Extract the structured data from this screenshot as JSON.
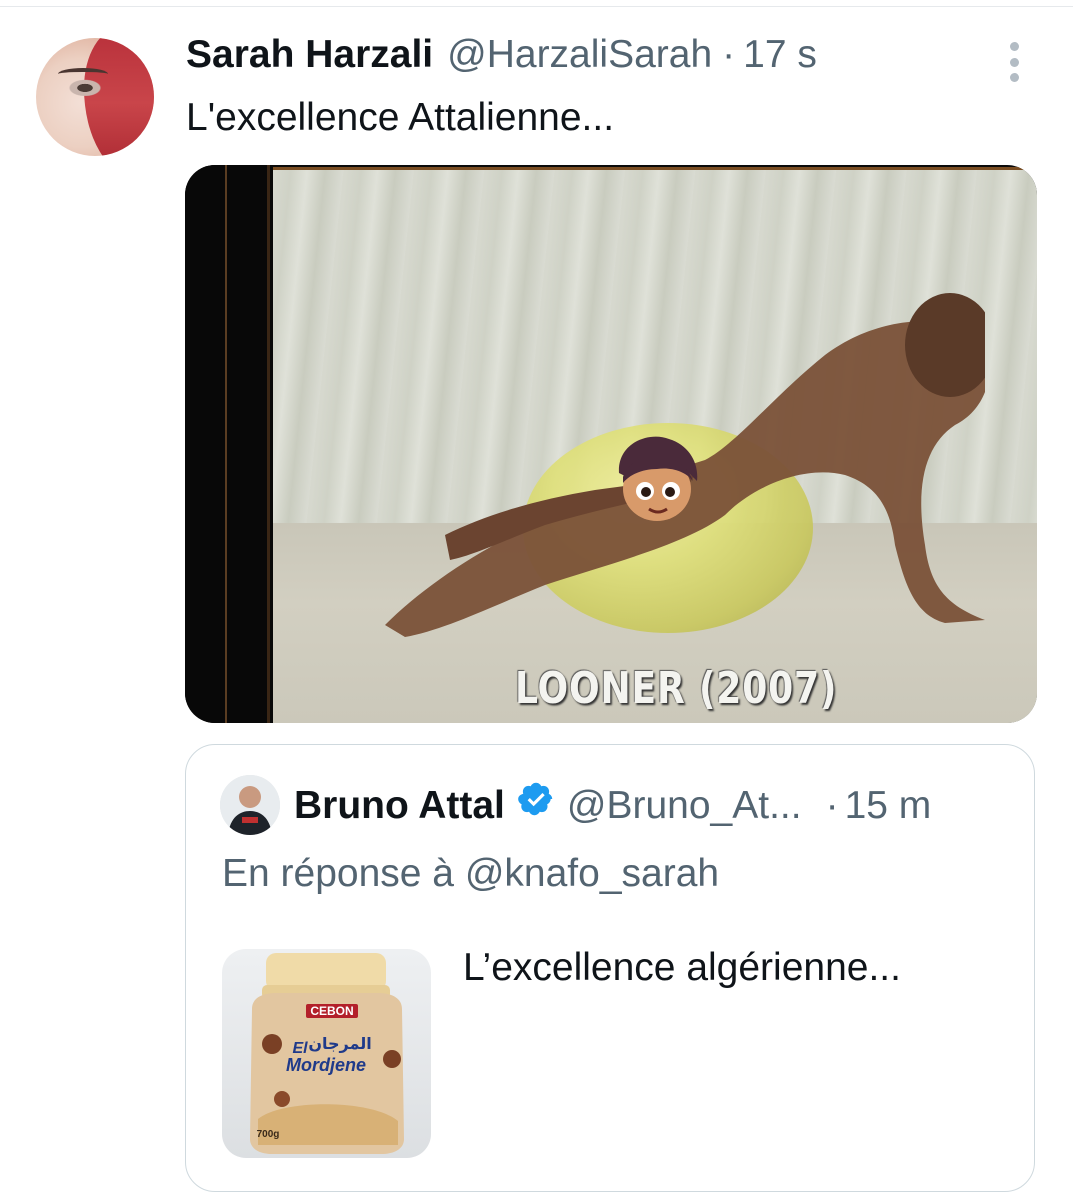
{
  "tweet": {
    "author_name": "Sarah Harzali",
    "author_handle": "@HarzaliSarah",
    "separator": "·",
    "time": "17 s",
    "text": "L'excellence Attalienne...",
    "media_caption": "LOONER (2007)"
  },
  "quoted_tweet": {
    "author_name": "Bruno Attal",
    "verified": true,
    "author_handle": "@Bruno_At...",
    "separator": "·",
    "time": "15 m",
    "reply_context": "En réponse à @knafo_sarah",
    "text": "L’excellence algérienne...",
    "product_brand": "CEBON",
    "product_name_line1": "El",
    "product_name_line2": "Mordjene",
    "product_arabic": "المرجان",
    "product_weight": "700g"
  },
  "colors": {
    "text_primary": "#0f1419",
    "text_secondary": "#536471",
    "verified_blue": "#1d9bf0",
    "border": "#cfd9de"
  },
  "icons": [
    "more-icon",
    "verified-badge-icon"
  ]
}
